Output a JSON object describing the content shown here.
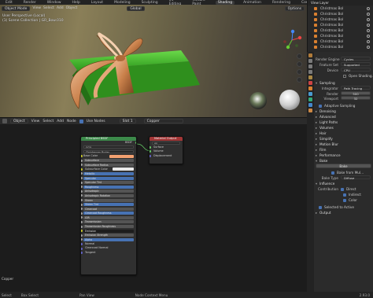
{
  "topbar": {
    "workspaces": [
      "Edit",
      "Render",
      "Window",
      "Help",
      "Layout",
      "Modeling",
      "Sculpting",
      "UV Editing",
      "Texture Paint",
      "Shading",
      "Animation",
      "Rendering",
      "Compositing",
      "Scripting"
    ],
    "active_workspace": "Shading",
    "scene_label": "Scene",
    "view_layer": "View Layer"
  },
  "viewport": {
    "mode": "Object Mode",
    "menus": [
      "View",
      "Select",
      "Add",
      "Object"
    ],
    "transform": "Global",
    "options": "Options",
    "info_line1": "User Perspective (Local)",
    "info_line2": "(1) Scene Collection | GR_Bow.010"
  },
  "node_editor": {
    "editor_icon": "node-editor-icon",
    "object_dropdown": "Object",
    "menus": [
      "View",
      "Select",
      "Add",
      "Node"
    ],
    "use_nodes_label": "Use Nodes",
    "slot": "Slot 1",
    "material": "Copper",
    "corner_label": "Copper"
  },
  "principled_node": {
    "title": "Principled BSDF",
    "output_label": "BSDF",
    "distribution": "GGX",
    "subsurface_method": "Christensen-Burley",
    "base_color_label": "Base Color",
    "base_color": "#f2a070",
    "rows": [
      {
        "label": "Subsurface",
        "kind": "field"
      },
      {
        "label": "Subsurface Radius",
        "kind": "field"
      },
      {
        "label": "Subsurface Color",
        "kind": "color",
        "color": "#e8e8e8"
      },
      {
        "label": "Metallic",
        "kind": "slider"
      },
      {
        "label": "Specular",
        "kind": "slider"
      },
      {
        "label": "Specular Tint",
        "kind": "field"
      },
      {
        "label": "Roughness",
        "kind": "slider"
      },
      {
        "label": "Anisotropic",
        "kind": "field"
      },
      {
        "label": "Anisotropic Rotation",
        "kind": "field"
      },
      {
        "label": "Sheen",
        "kind": "field"
      },
      {
        "label": "Sheen Tint",
        "kind": "slider"
      },
      {
        "label": "Clearcoat",
        "kind": "field"
      },
      {
        "label": "Clearcoat Roughness",
        "kind": "slider"
      },
      {
        "label": "IOR",
        "kind": "field"
      },
      {
        "label": "Transmission",
        "kind": "field"
      },
      {
        "label": "Transmission Roughness",
        "kind": "field"
      },
      {
        "label": "Emission",
        "kind": "dark"
      },
      {
        "label": "Emission Strength",
        "kind": "field"
      },
      {
        "label": "Alpha",
        "kind": "slider"
      },
      {
        "label": "Normal",
        "kind": "socket"
      },
      {
        "label": "Clearcoat Normal",
        "kind": "socket"
      },
      {
        "label": "Tangent",
        "kind": "socket"
      }
    ]
  },
  "output_node": {
    "title": "Material Output",
    "target": "All",
    "sockets": [
      "Surface",
      "Volume",
      "Displacement"
    ]
  },
  "outliner": {
    "items": [
      "Christmas Bol",
      "Christmas Bol",
      "Christmas Bol",
      "Christmas Bol",
      "Christmas Bol",
      "Christmas Bol",
      "Christmas Bol",
      "Christmas Bol"
    ]
  },
  "properties": {
    "render_engine_label": "Render Engine",
    "render_engine": "Cycles",
    "feature_set_label": "Feature Set",
    "feature_set": "Supported",
    "device_label": "Device",
    "device": "CPU",
    "open_shading_label": "Open Shading...",
    "sampling_header": "Sampling",
    "integrator_label": "Integrator",
    "integrator": "Path Tracing",
    "render_label": "Render",
    "render_samples": "500",
    "viewport_label": "Viewport",
    "viewport_samples": "32",
    "adaptive_sampling": "Adaptive Sampling",
    "denoising": "Denoising",
    "advanced": "Advanced",
    "light_paths": "Light Paths",
    "volumes": "Volumes",
    "hair": "Hair",
    "simplify": "Simplify",
    "motion_blur": "Motion Blur",
    "film": "Film",
    "performance": "Performance",
    "bake_header": "Bake",
    "bake_button": "Bake",
    "bake_from_multires": "Bake from Mul...",
    "bake_type_label": "Bake Type",
    "bake_type": "Diffuse",
    "influence": "Influence",
    "contribution_label": "Contribution",
    "direct": "Direct",
    "indirect": "Indirect",
    "color": "Color",
    "selected_to_active": "Selected to Active",
    "output": "Output"
  },
  "statusbar": {
    "items": [
      "Select",
      "Box Select",
      "Pan View",
      "Node Context Menu"
    ],
    "version": "2.93.0"
  },
  "colors": {
    "accent": "#4772b3",
    "gift_box": "#3fbf2a",
    "ribbon": "#c9804a",
    "shader_header": "#3c8a4a",
    "output_header": "#a33636"
  }
}
